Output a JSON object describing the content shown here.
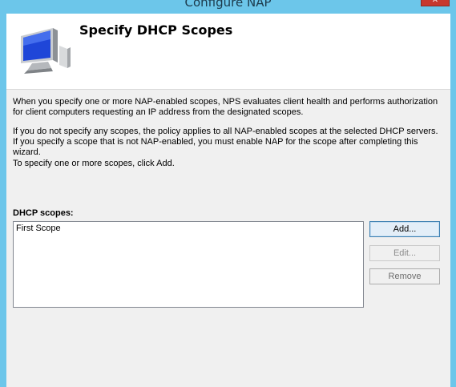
{
  "window": {
    "title": "Configure NAP",
    "close_glyph": "✕"
  },
  "header": {
    "title": "Specify DHCP Scopes",
    "icon": "computer-monitor-icon"
  },
  "body": {
    "paragraph1": "When you specify one or more NAP-enabled scopes, NPS evaluates client health and performs authorization for client computers requesting an IP address from the designated scopes.",
    "paragraph2": "If you do not specify any scopes, the policy applies to all NAP-enabled scopes at the selected DHCP servers. If you specify a scope that is not NAP-enabled, you must enable NAP for the scope after completing this wizard.",
    "paragraph3": "To specify one or more scopes, click Add."
  },
  "scopes": {
    "label": "DHCP scopes:",
    "items": [
      "First Scope"
    ]
  },
  "buttons": {
    "add": "Add...",
    "edit": "Edit...",
    "remove": "Remove"
  },
  "colors": {
    "frame": "#6cc6ea",
    "close": "#c7382e",
    "dialog_bg": "#f0f0f0"
  }
}
